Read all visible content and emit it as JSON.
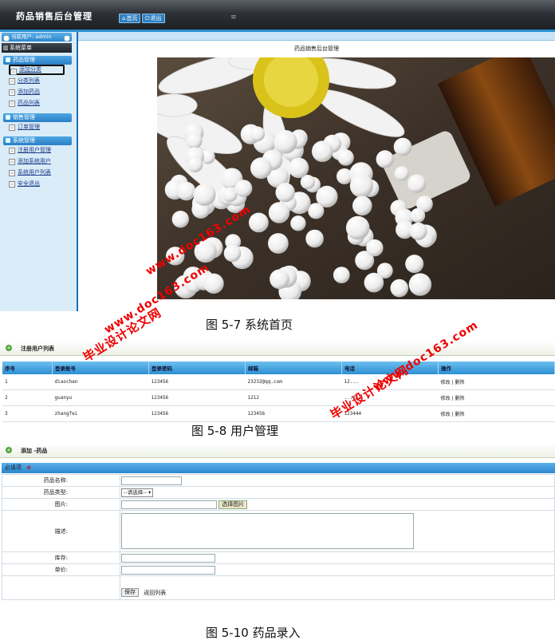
{
  "app": {
    "title": "药品销售后台管理",
    "home_button": "首页",
    "logout_button": "退出",
    "current_user": "当前用户: admin",
    "system_menu": "系统菜单",
    "content_title": "药品销售后台管理"
  },
  "sidebar": {
    "groups": [
      {
        "label": "药品管理",
        "items": [
          "添加分类",
          "分类列表",
          "添加药品",
          "药品列表"
        ]
      },
      {
        "label": "销售管理",
        "items": [
          "订单管理"
        ]
      },
      {
        "label": "系统管理",
        "items": [
          "注册用户管理",
          "添加系统用户",
          "系统用户列表",
          "安全退出"
        ]
      }
    ]
  },
  "captions": {
    "fig1": "图 5-7  系统首页",
    "fig2": "图 5-8 用户管理",
    "fig3": "图 5-10 药品录入"
  },
  "user_list": {
    "title": "注册用户列表",
    "columns": [
      "序号",
      "登录账号",
      "登录密码",
      "邮箱",
      "电话",
      "操作"
    ],
    "rows": [
      [
        "1",
        "diaochan",
        "123456",
        "23232@qq.com",
        "12...",
        "修改 | 删除"
      ],
      [
        "2",
        "guanyu",
        "123456",
        "1212",
        "...212",
        "修改 | 删除"
      ],
      [
        "3",
        "zhangfei",
        "123456",
        "123456",
        "123444",
        "修改 | 删除"
      ]
    ]
  },
  "add_form": {
    "title": "添加 -药品",
    "required_label": "必填项",
    "fields": {
      "name": "药品名称:",
      "type": "药品类型:",
      "type_select": "--请选择--",
      "image": "图片:",
      "image_button": "选择图片",
      "desc": "描述:",
      "stock": "库存:",
      "price": "单价:"
    },
    "save_button": "保存",
    "back_link": "返回列表"
  },
  "watermarks": {
    "line1": "毕业设计论文网",
    "line2": "www.doc163.com"
  }
}
